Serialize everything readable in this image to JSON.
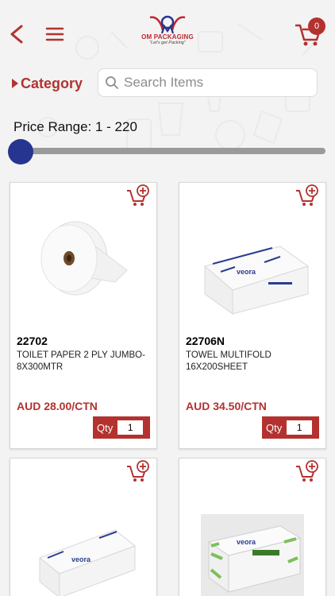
{
  "header": {
    "logo_name": "OM PACKAGING",
    "logo_tagline": "\"Let's get Packing\"",
    "cart_count": "0"
  },
  "filters": {
    "category_label": "Category",
    "search_placeholder": "Search Items",
    "price_range_label": "Price Range: 1 - 220",
    "price_min": 1,
    "price_max": 220
  },
  "colors": {
    "accent": "#b3322f",
    "slider_thumb": "#26358f"
  },
  "products": [
    {
      "code": "22702",
      "description": "TOILET PAPER 2 PLY JUMBO-8X300MTR",
      "price": "AUD 28.00/CTN",
      "qty_label": "Qty",
      "qty": "1",
      "image": "toilet-paper-roll"
    },
    {
      "code": "22706N",
      "description": "TOWEL MULTIFOLD 16X200SHEET",
      "price": "AUD 34.50/CTN",
      "qty_label": "Qty",
      "qty": "1",
      "image": "multifold-towel-pack"
    },
    {
      "code": "",
      "description": "",
      "price": "",
      "qty_label": "",
      "qty": "",
      "image": "towel-pack-blue"
    },
    {
      "code": "",
      "description": "",
      "price": "",
      "qty_label": "",
      "qty": "",
      "image": "towel-pack-green"
    }
  ]
}
